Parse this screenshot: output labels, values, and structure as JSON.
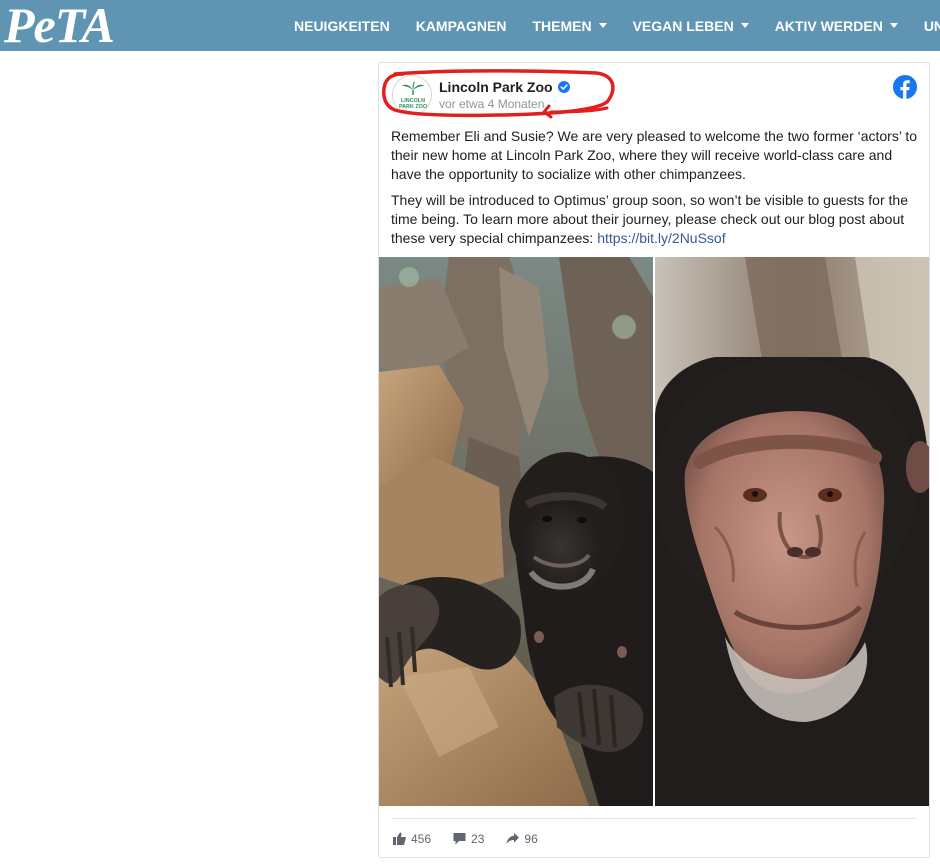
{
  "site": {
    "logo_text": "PeTA",
    "nav": [
      {
        "label": "NEUIGKEITEN",
        "has_dropdown": false
      },
      {
        "label": "KAMPAGNEN",
        "has_dropdown": false
      },
      {
        "label": "THEMEN",
        "has_dropdown": true
      },
      {
        "label": "VEGAN LEBEN",
        "has_dropdown": true
      },
      {
        "label": "AKTIV WERDEN",
        "has_dropdown": true
      },
      {
        "label": "UNTE",
        "has_dropdown": false
      }
    ],
    "colors": {
      "nav_bg": "#5f94b3",
      "link": "#385898",
      "facebook": "#1877f2",
      "annotation": "#e0201f"
    }
  },
  "post": {
    "avatar_text": [
      "LINCOLN",
      "PARK ZOO"
    ],
    "page_name": "Lincoln Park Zoo",
    "verified_icon": "verified-badge-icon",
    "timestamp": "vor etwa 4 Monaten",
    "paragraph_1": "Remember Eli and Susie? We are very pleased to welcome the two former ‘actors’ to their new home at Lincoln Park Zoo, where they will receive world-class care and have the opportunity to socialize with other chimpanzees.",
    "paragraph_2": "They will be introduced to Optimus’ group soon, so won’t be visible to guests for the time being. To learn more about their journey, please check out our blog post about these very special chimpanzees: ",
    "link_text": "https://bit.ly/2NuSsof",
    "likes": "456",
    "comments": "23",
    "shares": "96"
  }
}
